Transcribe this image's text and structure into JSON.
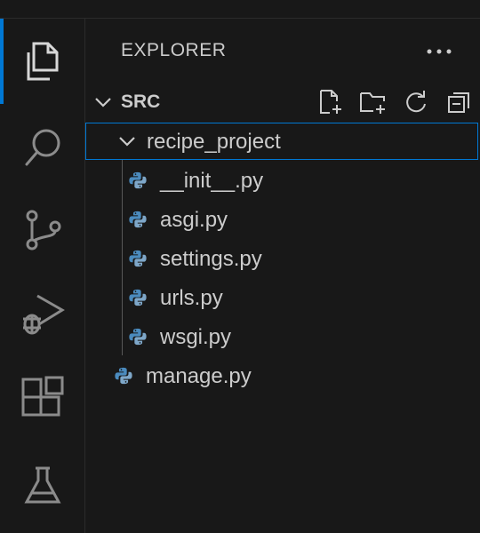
{
  "explorer": {
    "title": "EXPLORER",
    "more_icon": "ellipsis-icon"
  },
  "activity_bar": {
    "items": [
      {
        "name": "explorer",
        "icon": "files-icon",
        "active": true
      },
      {
        "name": "search",
        "icon": "search-icon"
      },
      {
        "name": "source-control",
        "icon": "source-control-icon"
      },
      {
        "name": "run-and-debug",
        "icon": "run-debug-icon"
      },
      {
        "name": "extensions",
        "icon": "extensions-icon"
      },
      {
        "name": "testing",
        "icon": "flask-icon"
      }
    ]
  },
  "section": {
    "label": "SRC",
    "actions": [
      {
        "name": "new-file",
        "icon": "new-file-icon"
      },
      {
        "name": "new-folder",
        "icon": "new-folder-icon"
      },
      {
        "name": "refresh",
        "icon": "refresh-icon"
      },
      {
        "name": "collapse-all",
        "icon": "collapse-all-icon"
      }
    ]
  },
  "tree": {
    "folder": {
      "label": "recipe_project",
      "expanded": true
    },
    "children": [
      {
        "label": "__init__.py",
        "icon": "python-icon"
      },
      {
        "label": "asgi.py",
        "icon": "python-icon"
      },
      {
        "label": "settings.py",
        "icon": "python-icon"
      },
      {
        "label": "urls.py",
        "icon": "python-icon"
      },
      {
        "label": "wsgi.py",
        "icon": "python-icon"
      }
    ],
    "root_files": [
      {
        "label": "manage.py",
        "icon": "python-icon"
      }
    ]
  },
  "colors": {
    "background": "#181818",
    "accent": "#0078d4",
    "text": "#cccccc",
    "python_blue": "#4b8bbe"
  }
}
